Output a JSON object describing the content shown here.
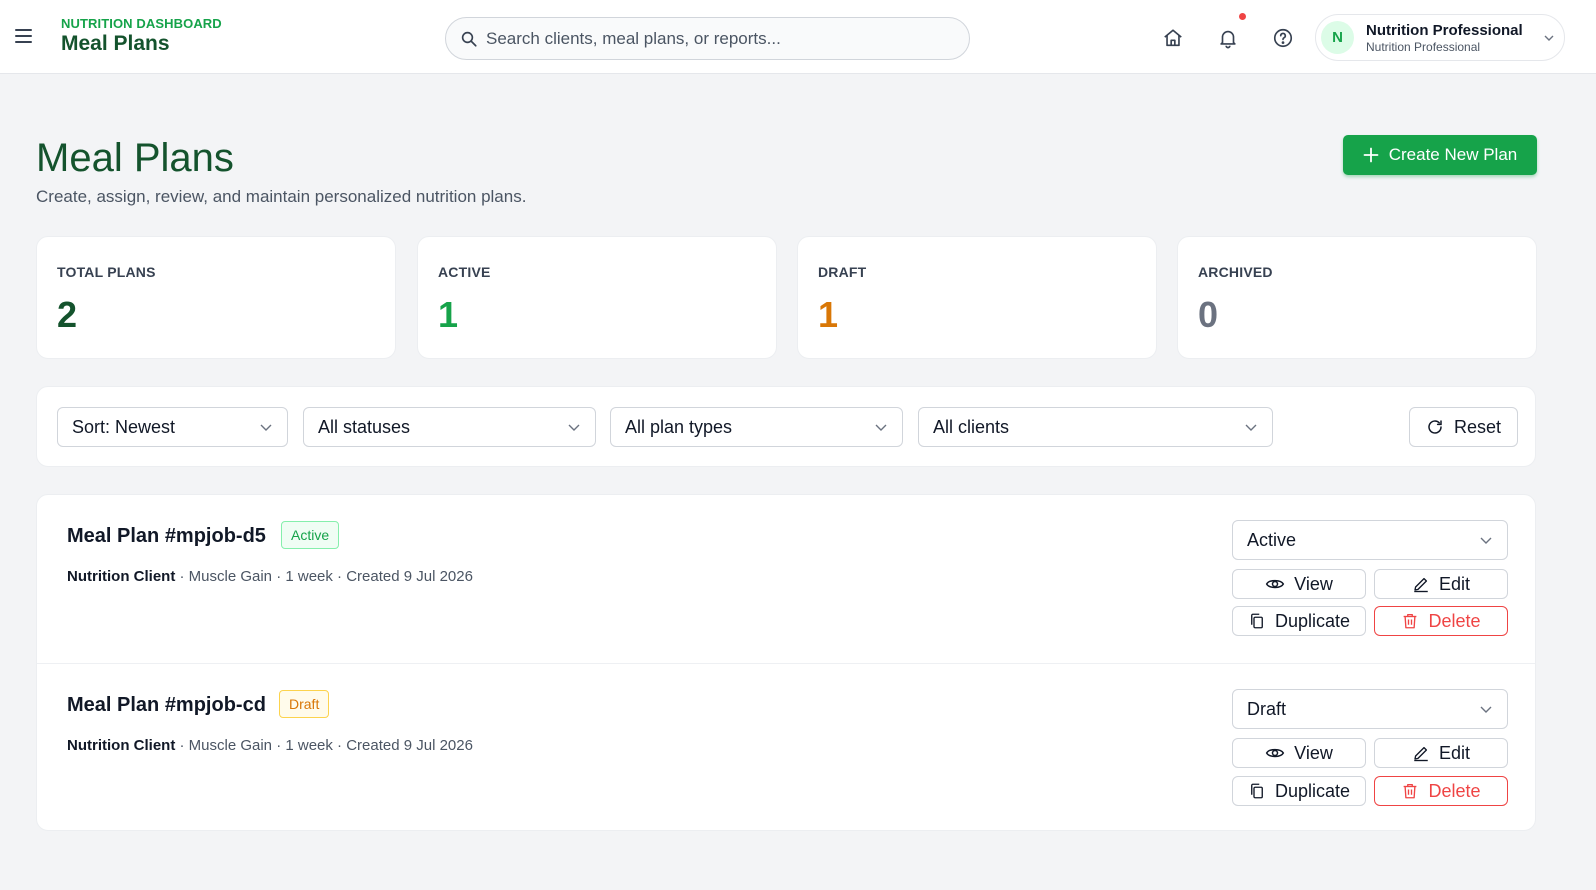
{
  "topbar": {
    "brand_sub": "NUTRITION DASHBOARD",
    "brand_title": "Meal Plans",
    "search_placeholder": "Search clients, meal plans, or reports...",
    "user": {
      "initial": "N",
      "name": "Nutrition Professional",
      "role": "Nutrition Professional"
    }
  },
  "header": {
    "title": "Meal Plans",
    "subtitle": "Create, assign, review, and maintain personalized nutrition plans.",
    "create_label": "Create New Plan"
  },
  "stats": [
    {
      "label": "TOTAL PLANS",
      "value": "2",
      "color": "#14532d"
    },
    {
      "label": "ACTIVE",
      "value": "1",
      "color": "#16a34a"
    },
    {
      "label": "DRAFT",
      "value": "1",
      "color": "#d97706"
    },
    {
      "label": "ARCHIVED",
      "value": "0",
      "color": "#6b7280"
    }
  ],
  "filters": {
    "sort": "Sort: Newest",
    "status": "All statuses",
    "plan_type": "All plan types",
    "client": "All clients",
    "reset_label": "Reset"
  },
  "plans": [
    {
      "title": "Meal Plan #mpjob-d5",
      "badge": "Active",
      "client": "Nutrition Client",
      "details": " · Muscle Gain · 1 week · Created 9 Jul 2026",
      "status_value": "Active",
      "view_label": "View",
      "edit_label": "Edit",
      "duplicate_label": "Duplicate",
      "delete_label": "Delete"
    },
    {
      "title": "Meal Plan #mpjob-cd",
      "badge": "Draft",
      "client": "Nutrition Client",
      "details": " · Muscle Gain · 1 week · Created 9 Jul 2026",
      "status_value": "Draft",
      "view_label": "View",
      "edit_label": "Edit",
      "duplicate_label": "Duplicate",
      "delete_label": "Delete"
    }
  ],
  "colors": {
    "accent": "#16a34a",
    "brand_dark": "#14532d",
    "danger": "#ef4444",
    "notification": "#ef4444"
  }
}
